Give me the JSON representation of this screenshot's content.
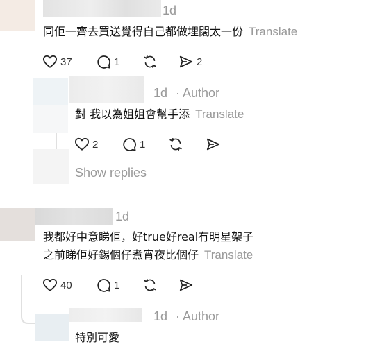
{
  "comments": [
    {
      "time": "1d",
      "author_tag": "",
      "lines": [
        "同佢一齊去買送覺得自己都做埋闊太一份"
      ],
      "translate": "Translate",
      "likes": "37",
      "replies": "1",
      "shares": "2"
    },
    {
      "time": "1d",
      "author_tag": "· Author",
      "lines": [
        "對 我以為姐姐會幫手添"
      ],
      "translate": "Translate",
      "likes": "2",
      "replies": "1",
      "shares": ""
    },
    {
      "time": "1d",
      "author_tag": "",
      "lines": [
        "我都好中意睇佢，好true好real冇明星架子",
        "之前睇佢好錫個仔煮宵夜比個仔"
      ],
      "translate": "Translate",
      "likes": "40",
      "replies": "1",
      "shares": ""
    },
    {
      "time": "1d",
      "author_tag": "· Author",
      "lines": [
        "特別可愛"
      ],
      "translate": "",
      "likes": "",
      "replies": "",
      "shares": ""
    }
  ],
  "show_replies": "Show replies",
  "icons": [
    "heart-icon",
    "comment-icon",
    "repost-icon",
    "send-icon"
  ]
}
